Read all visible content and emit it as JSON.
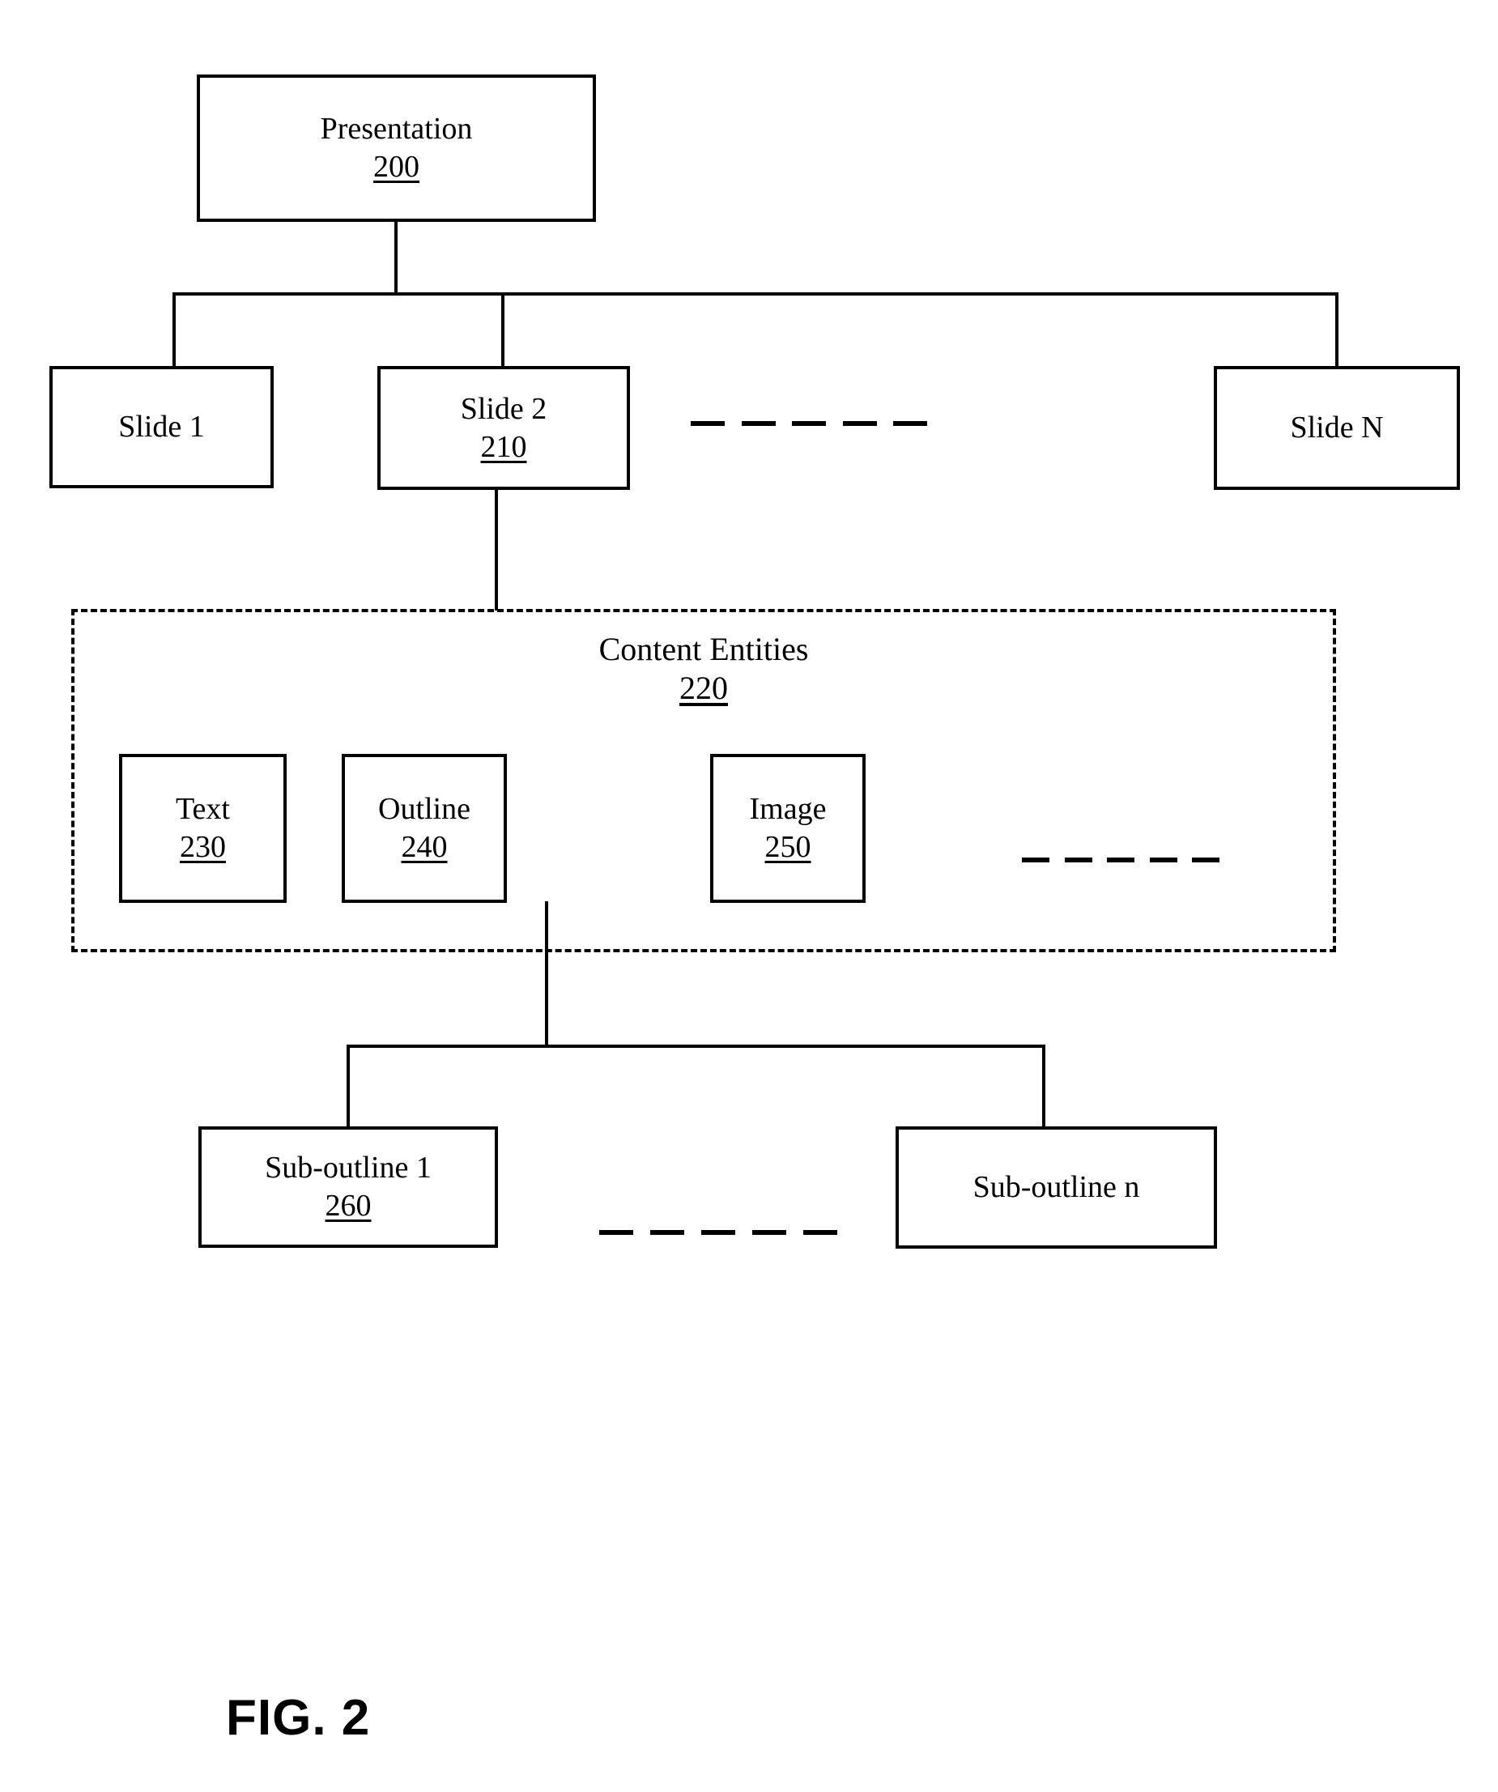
{
  "figure": {
    "caption": "FIG. 2",
    "title_node": {
      "label": "Presentation",
      "ref": "200"
    }
  },
  "slides": {
    "slide_1": {
      "label": "Slide 1",
      "ref": ""
    },
    "slide_2": {
      "label": "Slide 2",
      "ref": "210"
    },
    "slide_n": {
      "label": "Slide N",
      "ref": ""
    },
    "ellipsis_dashes": 5
  },
  "content_entities": {
    "title": "Content Entities",
    "ref": "220",
    "items": [
      {
        "label": "Text",
        "ref": "230"
      },
      {
        "label": "Outline",
        "ref": "240"
      },
      {
        "label": "Image",
        "ref": "250"
      }
    ],
    "ellipsis_dashes": 5
  },
  "sub_outlines": {
    "first": {
      "label": "Sub-outline 1",
      "ref": "260"
    },
    "last": {
      "label": "Sub-outline n",
      "ref": ""
    },
    "ellipsis_dashes": 5
  },
  "colors": {
    "stroke": "#000000",
    "background": "#ffffff"
  }
}
